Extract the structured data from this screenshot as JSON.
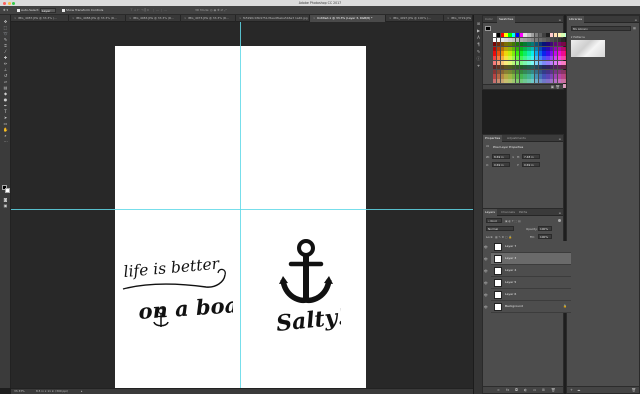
{
  "window": {
    "title": "Adobe Photoshop CC 2017"
  },
  "options_bar": {
    "auto_select_label": "Auto-Select:",
    "auto_select_value": "Layer",
    "show_transform_label": "Show Transform Controls",
    "mode_3d_label": "3D Mode:"
  },
  "tabs": [
    {
      "label": "IMG_4087.JPG @ 33.3% (...",
      "active": false
    },
    {
      "label": "IMG_4088.JPG @ 33.3% (R...",
      "active": false
    },
    {
      "label": "IMG_4083.JPG @ 33.3% (R...",
      "active": false
    },
    {
      "label": "IMG_4073.JPG @ 33.3% (R...",
      "active": false
    },
    {
      "label": "fb5990c03b9751d5ea4fbeba5b6a3 1a40.jpg",
      "active": false
    },
    {
      "label": "Untitled-1 @ 33.3% (Layer 3, RGB/8) *",
      "active": true
    },
    {
      "label": "IMG_4097.JPG @ 100% (...",
      "active": false
    },
    {
      "label": "IMG_3729.JPG",
      "active": false
    }
  ],
  "status_bar": {
    "zoom": "33.33%",
    "doc_size": "8.5 in x 11 in (300 ppi)"
  },
  "artwork": {
    "quote_line1": "life is better",
    "quote_line2": "on a boat",
    "salty": "Salty!"
  },
  "color_panel": {
    "tabs": [
      "Color",
      "Swatches"
    ],
    "active_tab": "Swatches"
  },
  "libraries_panel": {
    "tab": "Libraries",
    "library_name": "My Library",
    "section_label": "Patterns"
  },
  "properties_panel": {
    "tabs": [
      "Properties",
      "Adjustments"
    ],
    "active_tab": "Properties",
    "heading": "Pixel Layer Properties",
    "w_label": "W:",
    "w_value": "8.69 in",
    "h_label": "H:",
    "h_value": "7.48 in",
    "x_label": "X:",
    "x_value": "0.69 in",
    "y_label": "Y:",
    "y_value": "0.69 in"
  },
  "layers_panel": {
    "tabs": [
      "Layers",
      "Channels",
      "Paths"
    ],
    "active_tab": "Layers",
    "kind_label": "Kind",
    "blend_mode": "Normal",
    "opacity_label": "Opacity:",
    "opacity_value": "100%",
    "lock_label": "Lock:",
    "fill_label": "Fill:",
    "fill_value": "100%",
    "layers": [
      {
        "name": "Layer 7",
        "selected": false,
        "visible": true
      },
      {
        "name": "Layer 3",
        "selected": true,
        "visible": true
      },
      {
        "name": "Layer 4",
        "selected": false,
        "visible": true
      },
      {
        "name": "Layer 5",
        "selected": false,
        "visible": true
      },
      {
        "name": "Layer 6",
        "selected": false,
        "visible": true
      },
      {
        "name": "Background",
        "selected": false,
        "visible": true
      }
    ]
  },
  "colors": {
    "guide": "#5fd8e8",
    "selected_layer": "#6a6a6a",
    "panel_bg": "#4d4d4d",
    "canvas_bg": "#282828"
  }
}
